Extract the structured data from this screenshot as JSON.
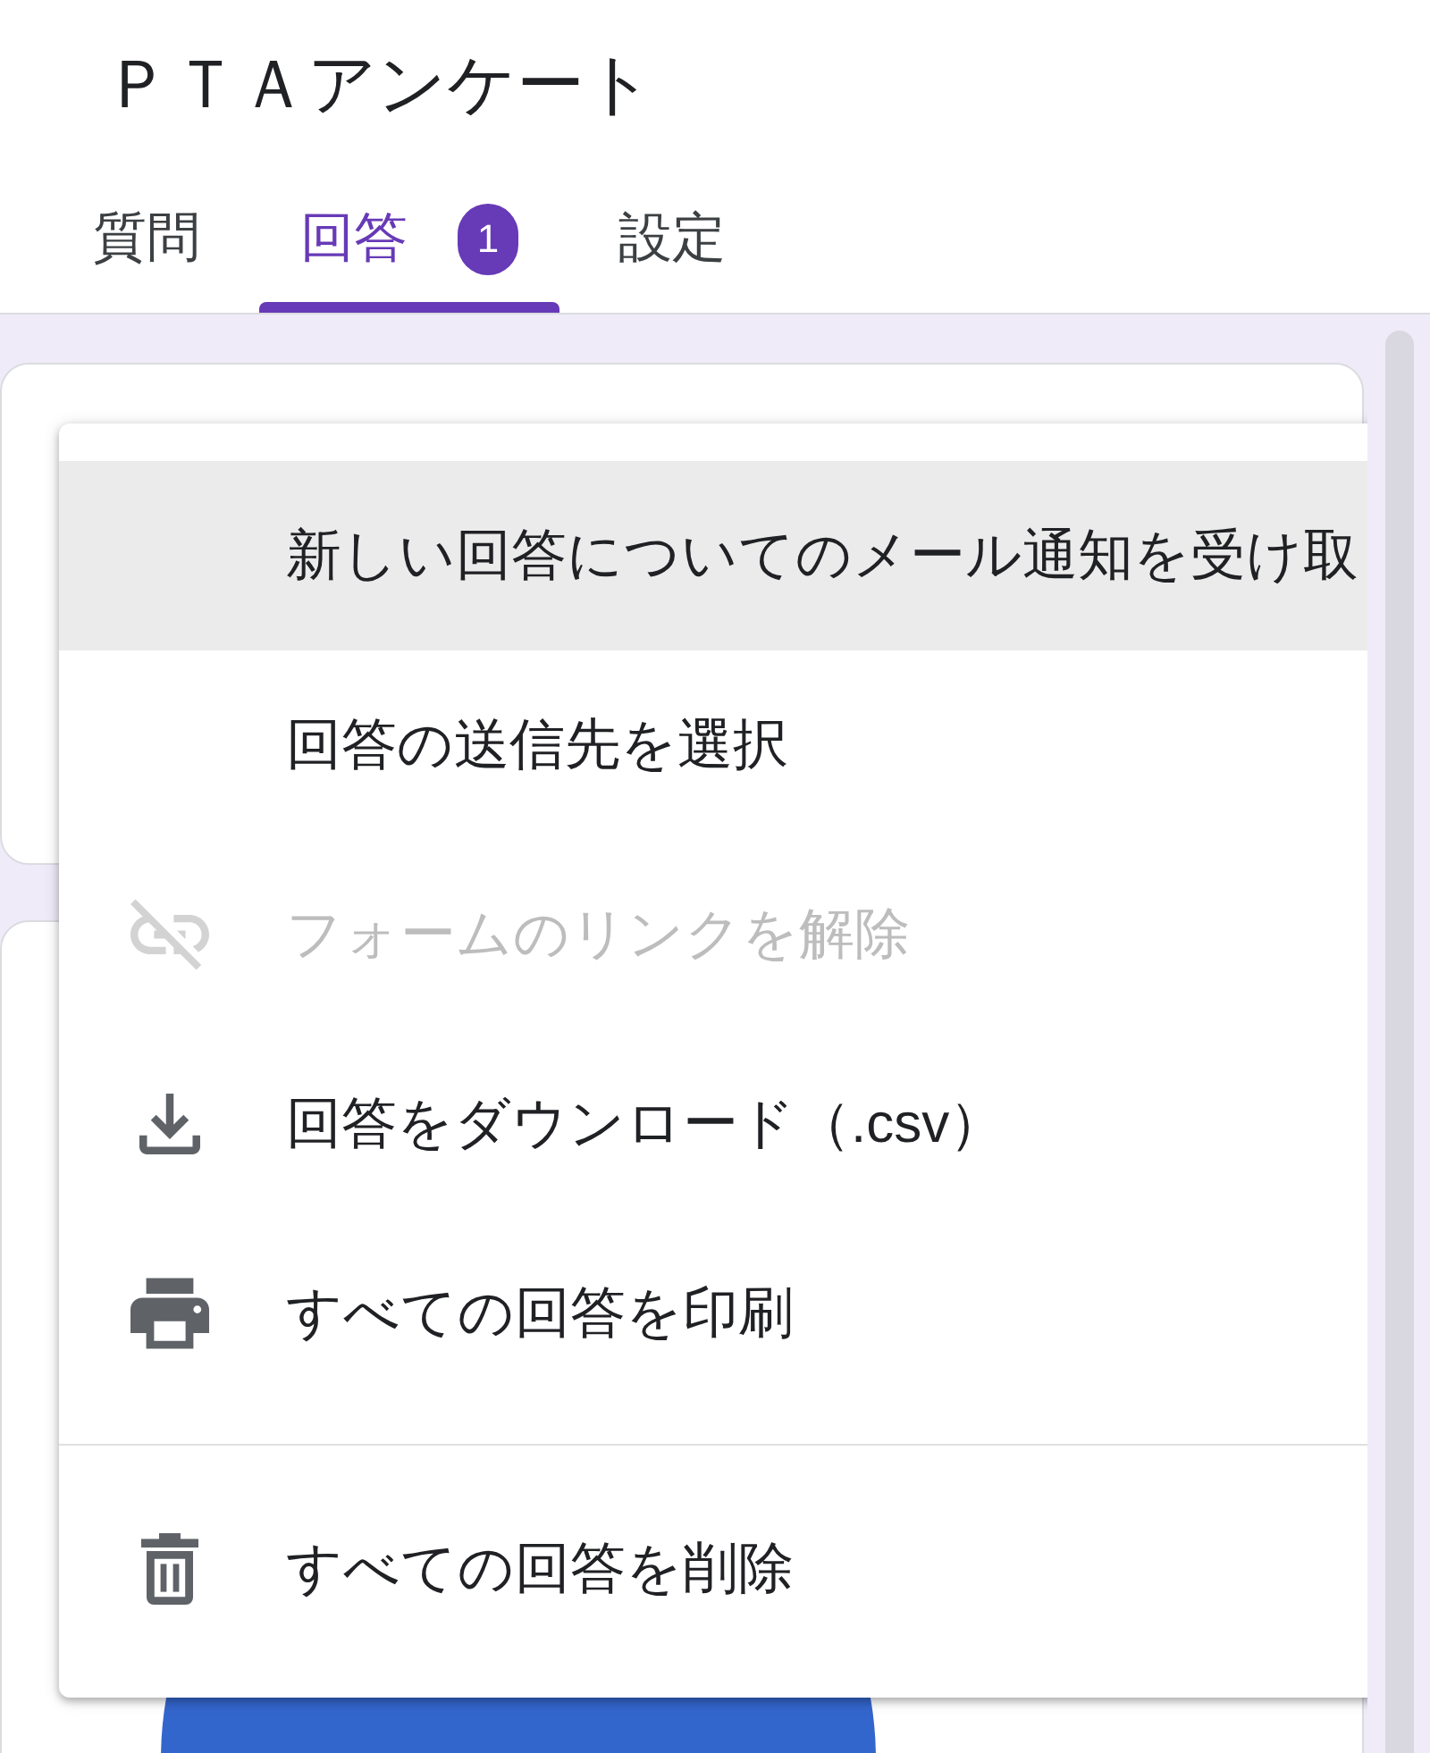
{
  "form": {
    "title": "ＰＴＡアンケート"
  },
  "tabs": [
    {
      "label": "質問",
      "selected": false
    },
    {
      "label": "回答",
      "selected": true,
      "badge": "1"
    },
    {
      "label": "設定",
      "selected": false
    }
  ],
  "menu": {
    "sections": [
      {
        "items": [
          {
            "kind": "plain",
            "label": "新しい回答についてのメール通知を受け取",
            "highlighted": true,
            "disabled": false
          },
          {
            "kind": "plain",
            "label": "回答の送信先を選択",
            "highlighted": false,
            "disabled": false
          },
          {
            "kind": "unlink",
            "label": "フォームのリンクを解除",
            "highlighted": false,
            "disabled": true
          },
          {
            "kind": "download",
            "label": "回答をダウンロード（.csv）",
            "highlighted": false,
            "disabled": false
          },
          {
            "kind": "print",
            "label": "すべての回答を印刷",
            "highlighted": false,
            "disabled": false
          }
        ]
      },
      {
        "items": [
          {
            "kind": "delete",
            "label": "すべての回答を削除",
            "highlighted": false,
            "disabled": false
          }
        ]
      }
    ]
  }
}
